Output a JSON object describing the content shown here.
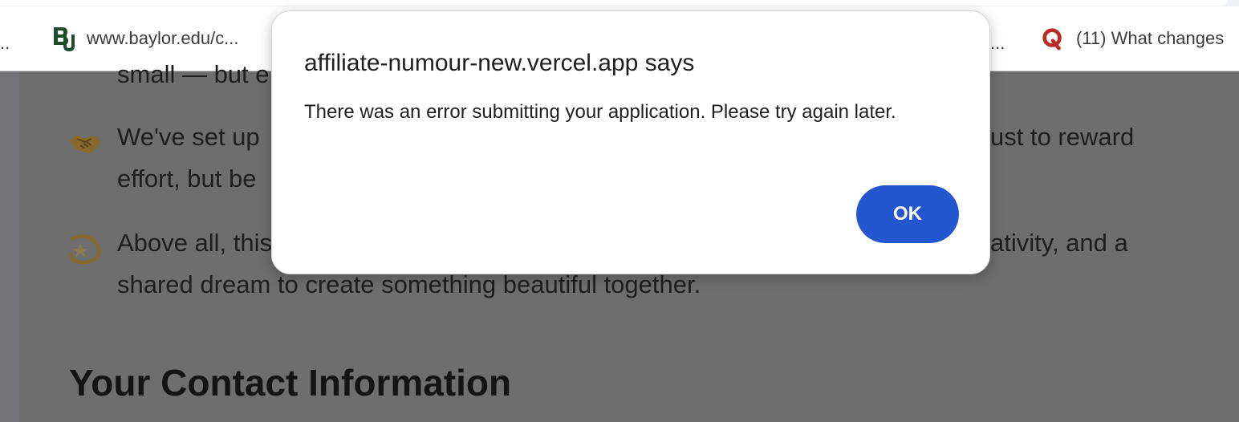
{
  "bookmarks": {
    "leading_ellipsis": "..",
    "baylor": {
      "label": "www.baylor.edu/c...",
      "icon": "baylor-logo-icon"
    },
    "hidden_ellipsis": "...",
    "quora": {
      "label": "(11) What changes",
      "icon": "quora-logo-icon"
    }
  },
  "page": {
    "line1": "small — but e",
    "para2_line1_start": "We've set up",
    "para2_line1_end": "ust to reward",
    "para2_line2": "effort, but be",
    "para3_line1_start": "Above all, this",
    "para3_line1_end": "ativity, and a",
    "para3_line2": "shared dream to create something beautiful together.",
    "section_heading": "Your Contact Information",
    "emoji_handshake": "handshake-icon",
    "emoji_dizzy": "dizzy-star-icon"
  },
  "dialog": {
    "title": "affiliate-numour-new.vercel.app says",
    "message": "There was an error submitting your application. Please try again later.",
    "ok_label": "OK"
  },
  "colors": {
    "ok_button": "#2457cf",
    "overlay_page": "#6e6e6e",
    "baylor_green": "#1f4d2b",
    "quora_red": "#b92b27"
  }
}
